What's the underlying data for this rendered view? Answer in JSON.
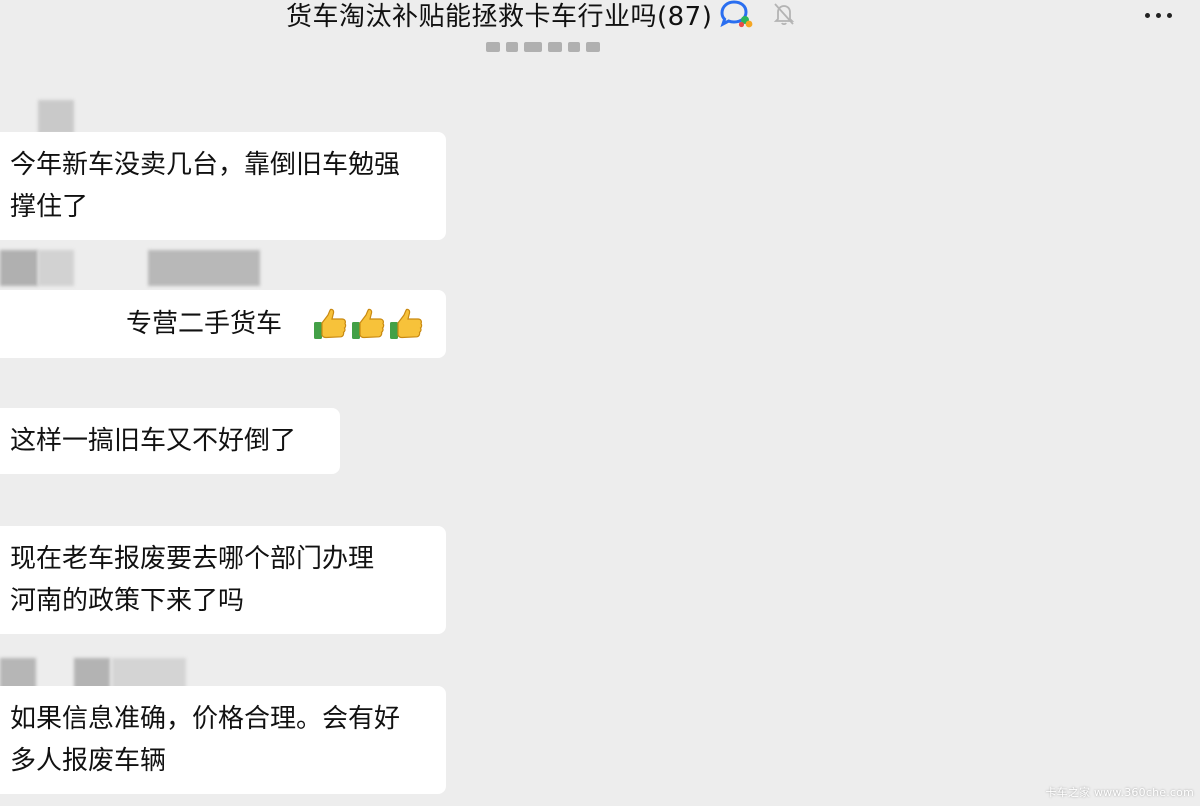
{
  "header": {
    "title": "货车淘汰补贴能拯救卡车行业吗(87)",
    "ai_icon": "chat-ai-icon",
    "mute_icon": "bell-muted-icon",
    "more_icon": "more-dots-icon"
  },
  "messages": [
    {
      "lines": [
        "今年新车没卖几台，靠倒旧车勉强",
        "撑住了"
      ]
    },
    {
      "text": "专营二手货车",
      "emoji": "👍👍👍"
    },
    {
      "lines": [
        "这样一搞旧车又不好倒了"
      ]
    },
    {
      "lines": [
        "现在老车报废要去哪个部门办理",
        "河南的政策下来了吗"
      ]
    },
    {
      "lines": [
        "如果信息准确，价格合理。会有好",
        "多人报废车辆"
      ]
    }
  ],
  "watermark": "卡车之家 www.360che.com",
  "colors": {
    "background": "#ededed",
    "bubble": "#ffffff",
    "text": "#111111"
  }
}
